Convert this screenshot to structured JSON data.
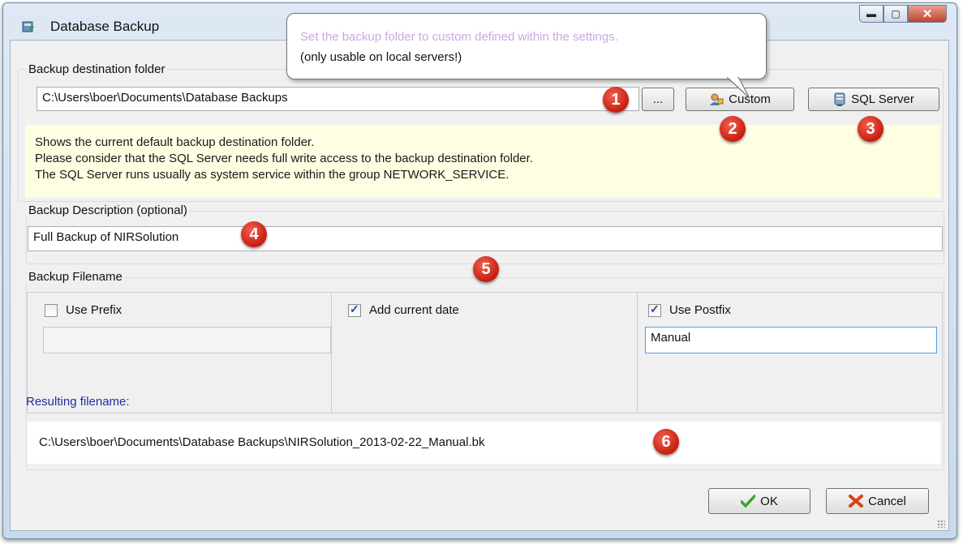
{
  "window": {
    "title": "Database Backup",
    "icon": "database-backup-icon",
    "controls": [
      "minimize",
      "maximize",
      "close"
    ]
  },
  "tooltip": {
    "line1": "Set the backup folder to custom defined within the settings.",
    "line2": "(only usable on local servers!)"
  },
  "destination": {
    "group_label": "Backup destination folder",
    "path": "C:\\Users\\boer\\Documents\\Database Backups",
    "browse_label": "...",
    "custom_label": "Custom",
    "sql_server_label": "SQL Server",
    "hint_lines": [
      "Shows the current default backup destination folder.",
      "Please consider that the SQL Server needs full write access to the backup destination folder.",
      "The SQL Server runs usually as system service within the group NETWORK_SERVICE."
    ]
  },
  "description": {
    "group_label": "Backup Description (optional)",
    "value": "Full Backup of NIRSolution"
  },
  "filename": {
    "group_label": "Backup Filename",
    "use_prefix": {
      "label": "Use Prefix",
      "checked": false,
      "value": ""
    },
    "add_date": {
      "label": "Add current date",
      "checked": true
    },
    "use_postfix": {
      "label": "Use Postfix",
      "checked": true,
      "value": "Manual"
    },
    "result_label": "Resulting filename:",
    "result_value": "C:\\Users\\boer\\Documents\\Database Backups\\NIRSolution_2013-02-22_Manual.bk"
  },
  "buttons": {
    "ok_label": "OK",
    "cancel_label": "Cancel"
  },
  "markers": [
    "1",
    "2",
    "3",
    "4",
    "5",
    "6"
  ],
  "colors": {
    "marker": "#d8281a",
    "hint_bg": "#fefee3",
    "result_label": "#1c2fa3"
  }
}
